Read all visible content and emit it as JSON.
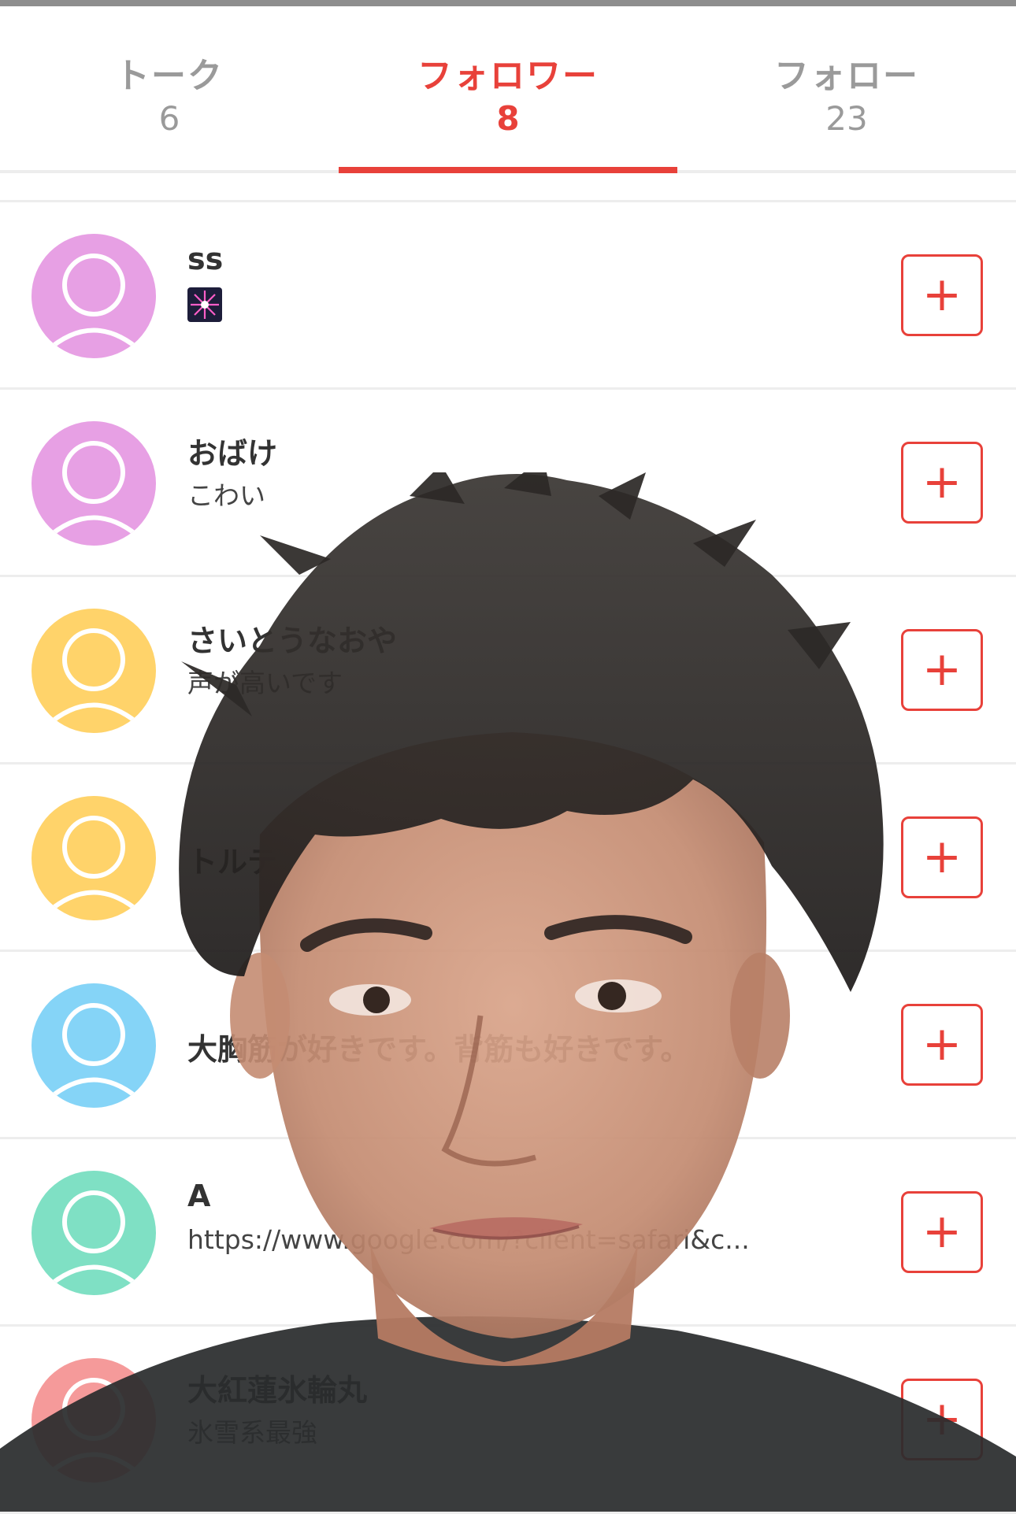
{
  "tabs": [
    {
      "label": "トーク",
      "count": "6",
      "active": false
    },
    {
      "label": "フォロワー",
      "count": "8",
      "active": true
    },
    {
      "label": "フォロー",
      "count": "23",
      "active": false
    }
  ],
  "followers": [
    {
      "name": "ss",
      "bio": "",
      "bio_icon": "fireworks-emoji",
      "avatar_color": "#e7a0e4"
    },
    {
      "name": "おばけ",
      "bio": "こわい",
      "avatar_color": "#e7a0e4"
    },
    {
      "name": "さいとうなおや",
      "bio": "声が高いです",
      "avatar_color": "#ffd36a"
    },
    {
      "name": "トルテ",
      "bio": "",
      "avatar_color": "#ffd36a"
    },
    {
      "name": "大胸筋が好きです。背筋も好きです。",
      "bio": "",
      "avatar_color": "#85d4f7"
    },
    {
      "name": "A",
      "bio": "https://www.google.com/?client=safari&c...",
      "avatar_color": "#7fe0c4"
    },
    {
      "name": "大紅蓮氷輪丸",
      "bio": "氷雪系最強",
      "avatar_color": "#f59a9a"
    }
  ],
  "follow_button_label": "+",
  "colors": {
    "accent": "#e8413a",
    "divider": "#ededed",
    "inactive_text": "#9a9a9a"
  }
}
